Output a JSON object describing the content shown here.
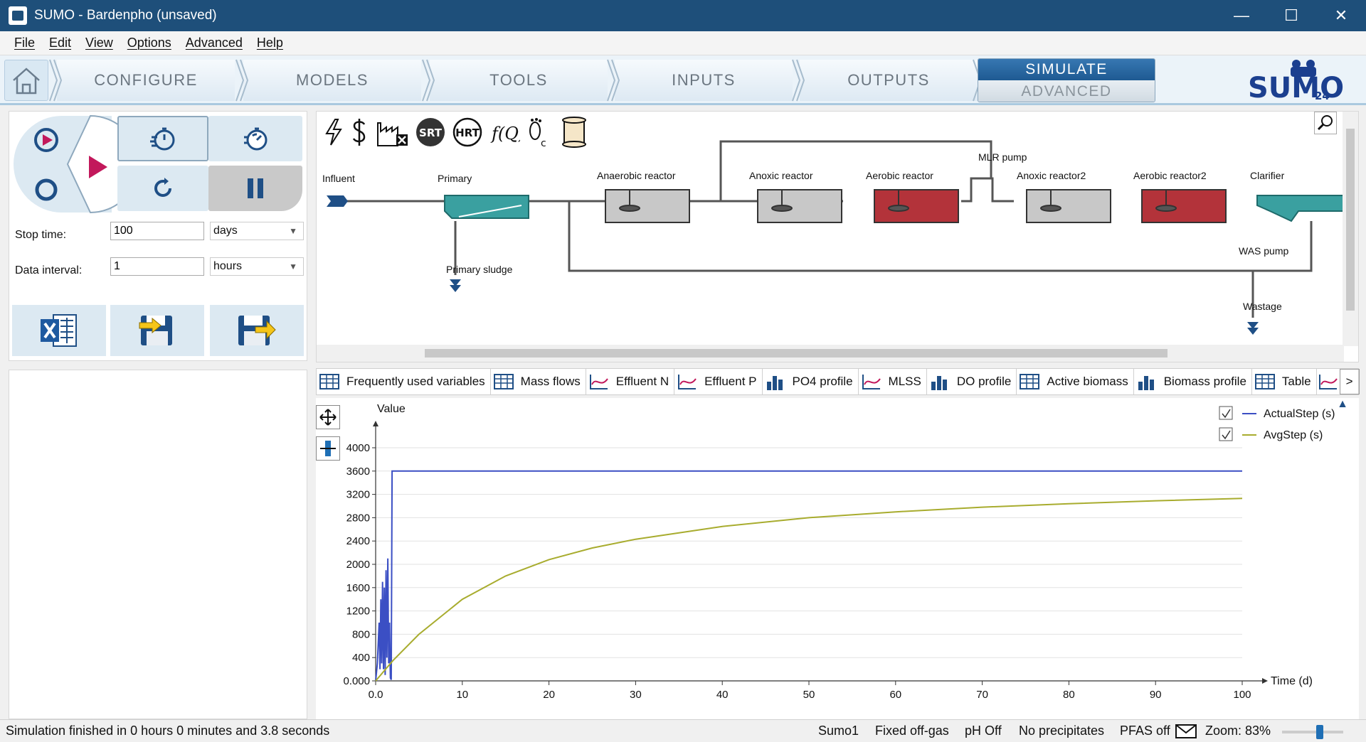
{
  "window": {
    "title": "SUMO - Bardenpho (unsaved)",
    "min": "—",
    "max": "☐",
    "close": "✕"
  },
  "menu": [
    "File",
    "Edit",
    "View",
    "Options",
    "Advanced",
    "Help"
  ],
  "ribbon": {
    "tabs": [
      "CONFIGURE",
      "MODELS",
      "TOOLS",
      "INPUTS",
      "OUTPUTS"
    ],
    "simulate": "SIMULATE",
    "advanced": "ADVANCED",
    "logo": "SUMO",
    "logo_version": "24"
  },
  "controls": {
    "stop_time_label": "Stop time:",
    "stop_time_value": "100",
    "stop_time_unit": "days",
    "data_interval_label": "Data interval:",
    "data_interval_value": "1",
    "data_interval_unit": "hours"
  },
  "flowsheet": {
    "toolbar_icons": [
      "lightning-icon",
      "dollar-icon",
      "factory-x-icon",
      "srt-icon",
      "hrt-icon",
      "fq-icon",
      "footprint-icon",
      "scroll-icon"
    ],
    "srt": "SRT",
    "hrt": "HRT",
    "fq": "f(Q)",
    "units": [
      "Influent",
      "Primary",
      "Primary sludge",
      "Anaerobic reactor",
      "Anoxic reactor",
      "Aerobic reactor",
      "MLR pump",
      "Anoxic reactor2",
      "Aerobic reactor2",
      "Clarifier",
      "WAS pump",
      "Wastage"
    ]
  },
  "chart_tabs": [
    "Frequently used variables",
    "Mass flows",
    "Effluent N",
    "Effluent P",
    "PO4 profile",
    "MLSS",
    "DO profile",
    "Active biomass",
    "Biomass profile",
    "Table"
  ],
  "chart_tabs_more": ">",
  "chart_data": {
    "type": "line",
    "title": "",
    "ylabel": "Value",
    "xlabel": "Time  (d)",
    "xlim": [
      0,
      100
    ],
    "ylim": [
      0,
      4000
    ],
    "x_ticks": [
      "0.0",
      "10",
      "20",
      "30",
      "40",
      "50",
      "60",
      "70",
      "80",
      "90",
      "100"
    ],
    "y_ticks": [
      "0.000",
      "400",
      "800",
      "1200",
      "1600",
      "2000",
      "2400",
      "2800",
      "3200",
      "3600",
      "4000"
    ],
    "legend_position": "top-right",
    "series": [
      {
        "name": "ActualStep  (s)",
        "color": "#3b4fc4",
        "x": [
          0,
          0.2,
          0.4,
          0.5,
          0.6,
          0.7,
          0.8,
          0.9,
          1.0,
          1.1,
          1.2,
          1.3,
          1.4,
          1.5,
          1.6,
          1.7,
          1.8,
          1.9,
          2.0,
          10,
          20,
          40,
          60,
          80,
          100
        ],
        "y": [
          0,
          300,
          1000,
          200,
          1400,
          300,
          1700,
          200,
          1600,
          100,
          1900,
          400,
          2100,
          300,
          1000,
          50,
          20,
          3600,
          3600,
          3600,
          3600,
          3600,
          3600,
          3600,
          3600
        ]
      },
      {
        "name": "AvgStep  (s)",
        "color": "#a8ac2e",
        "x": [
          0,
          2,
          5,
          10,
          15,
          20,
          25,
          30,
          40,
          50,
          60,
          70,
          80,
          90,
          100
        ],
        "y": [
          0,
          350,
          800,
          1400,
          1800,
          2080,
          2280,
          2430,
          2650,
          2800,
          2900,
          2980,
          3040,
          3090,
          3130
        ]
      }
    ]
  },
  "status": {
    "message": "Simulation finished in 0 hours 0 minutes and 3.8 seconds",
    "model": "Sumo1",
    "offgas": "Fixed off-gas",
    "ph": "pH Off",
    "precip": "No precipitates",
    "pfas": "PFAS off",
    "zoom": "Zoom: 83%",
    "zoom_level": 0.62
  }
}
